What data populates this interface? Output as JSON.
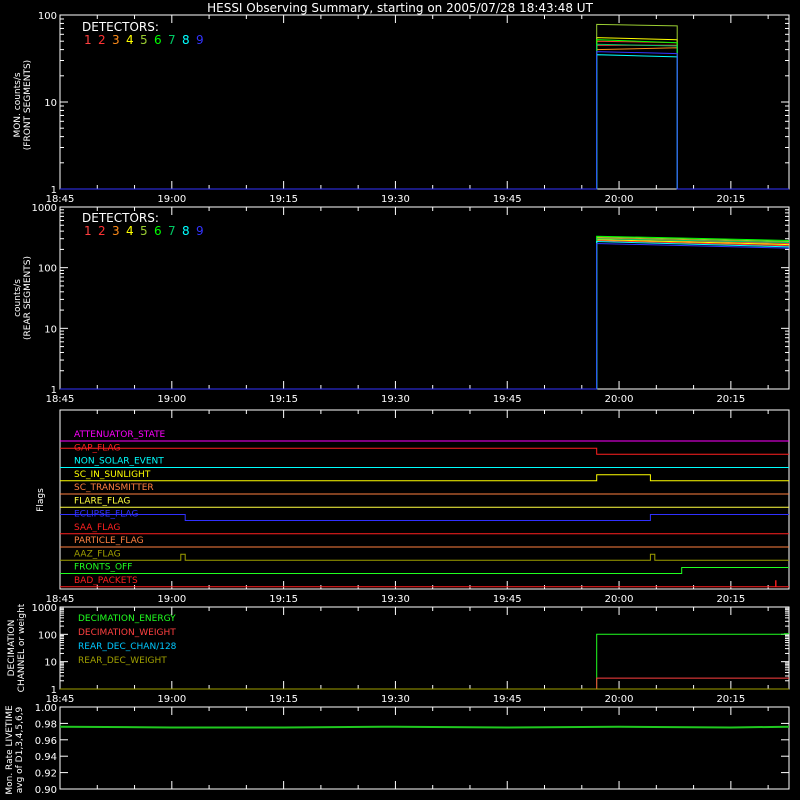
{
  "page": {
    "title": "HESSI Observing Summary, starting on 2005/07/28 18:43:48 UT"
  },
  "time_ticks": [
    "18:45",
    "19:00",
    "19:15",
    "19:30",
    "19:45",
    "20:00",
    "20:15"
  ],
  "chart_data": [
    {
      "type": "line",
      "panel": "front",
      "ylabel_1": "MON. counts/s",
      "ylabel_2": "(FRONT SEGMENTS)",
      "yscale": "log",
      "ylim": [
        1,
        100
      ],
      "yticks": [
        "1",
        "10",
        "100"
      ],
      "legend_title": "DETECTORS:",
      "series": [
        {
          "name": "1",
          "color": "#ff4040",
          "values": [
            [
              18.75,
              1
            ],
            [
              19.95,
              1
            ],
            [
              19.95,
              45
            ],
            [
              20.13,
              45
            ],
            [
              20.13,
              1
            ],
            [
              20.38,
              1
            ]
          ]
        },
        {
          "name": "2",
          "color": "#ff3333",
          "values": [
            [
              18.75,
              1
            ],
            [
              19.95,
              1
            ],
            [
              19.95,
              50
            ],
            [
              20.13,
              48
            ],
            [
              20.13,
              1
            ],
            [
              20.38,
              1
            ]
          ]
        },
        {
          "name": "3",
          "color": "#ff8c1a",
          "values": [
            [
              18.75,
              1
            ],
            [
              19.95,
              1
            ],
            [
              19.95,
              40
            ],
            [
              20.13,
              42
            ],
            [
              20.13,
              1
            ],
            [
              20.38,
              1
            ]
          ]
        },
        {
          "name": "4",
          "color": "#ffff00",
          "values": [
            [
              18.75,
              1
            ],
            [
              19.95,
              1
            ],
            [
              19.95,
              55
            ],
            [
              20.13,
              52
            ],
            [
              20.13,
              1
            ],
            [
              20.38,
              1
            ]
          ]
        },
        {
          "name": "5",
          "color": "#9acd32",
          "values": [
            [
              18.75,
              1
            ],
            [
              19.95,
              1
            ],
            [
              19.95,
              78
            ],
            [
              20.13,
              75
            ],
            [
              20.13,
              1
            ],
            [
              20.38,
              1
            ]
          ]
        },
        {
          "name": "6",
          "color": "#00ff00",
          "values": [
            [
              18.75,
              1
            ],
            [
              19.95,
              1
            ],
            [
              19.95,
              52
            ],
            [
              20.13,
              48
            ],
            [
              20.13,
              1
            ],
            [
              20.38,
              1
            ]
          ]
        },
        {
          "name": "7",
          "color": "#00c864",
          "values": [
            [
              18.75,
              1
            ],
            [
              19.95,
              1
            ],
            [
              19.95,
              46
            ],
            [
              20.13,
              44
            ],
            [
              20.13,
              1
            ],
            [
              20.38,
              1
            ]
          ]
        },
        {
          "name": "8",
          "color": "#00ffff",
          "values": [
            [
              18.75,
              1
            ],
            [
              19.95,
              1
            ],
            [
              19.95,
              35
            ],
            [
              20.13,
              33
            ],
            [
              20.13,
              1
            ],
            [
              20.38,
              1
            ]
          ]
        },
        {
          "name": "9",
          "color": "#3333ff",
          "values": [
            [
              18.75,
              1
            ],
            [
              19.95,
              1
            ],
            [
              19.95,
              38
            ],
            [
              20.13,
              36
            ],
            [
              20.13,
              1
            ],
            [
              20.38,
              1
            ]
          ]
        }
      ]
    },
    {
      "type": "line",
      "panel": "rear",
      "ylabel_1": "counts/s",
      "ylabel_2": "(REAR SEGMENTS)",
      "yscale": "log",
      "ylim": [
        1,
        1000
      ],
      "yticks": [
        "1",
        "10",
        "100",
        "1000"
      ],
      "legend_title": "DETECTORS:",
      "series": [
        {
          "name": "1",
          "color": "#ff4040",
          "values": [
            [
              18.75,
              1
            ],
            [
              19.95,
              1
            ],
            [
              19.95,
              300
            ],
            [
              20.38,
              250
            ]
          ]
        },
        {
          "name": "2",
          "color": "#ff3333",
          "values": [
            [
              18.75,
              1
            ],
            [
              19.95,
              1
            ],
            [
              19.95,
              280
            ],
            [
              20.38,
              230
            ]
          ]
        },
        {
          "name": "3",
          "color": "#ff8c1a",
          "values": [
            [
              18.75,
              1
            ],
            [
              19.95,
              1
            ],
            [
              19.95,
              310
            ],
            [
              20.38,
              260
            ]
          ]
        },
        {
          "name": "4",
          "color": "#ffff00",
          "values": [
            [
              18.75,
              1
            ],
            [
              19.95,
              1
            ],
            [
              19.95,
              290
            ],
            [
              20.38,
              240
            ]
          ]
        },
        {
          "name": "5",
          "color": "#9acd32",
          "values": [
            [
              18.75,
              1
            ],
            [
              19.95,
              1
            ],
            [
              19.95,
              320
            ],
            [
              20.38,
              270
            ]
          ]
        },
        {
          "name": "6",
          "color": "#00ff00",
          "values": [
            [
              18.75,
              1
            ],
            [
              19.95,
              1
            ],
            [
              19.95,
              330
            ],
            [
              20.38,
              280
            ]
          ]
        },
        {
          "name": "7",
          "color": "#00c864",
          "values": [
            [
              18.75,
              1
            ],
            [
              19.95,
              1
            ],
            [
              19.95,
              300
            ],
            [
              20.38,
              260
            ]
          ]
        },
        {
          "name": "8",
          "color": "#00ffff",
          "values": [
            [
              18.75,
              1
            ],
            [
              19.95,
              1
            ],
            [
              19.95,
              270
            ],
            [
              20.38,
              220
            ]
          ]
        },
        {
          "name": "9",
          "color": "#3333ff",
          "values": [
            [
              18.75,
              1
            ],
            [
              19.95,
              1
            ],
            [
              19.95,
              250
            ],
            [
              20.38,
              210
            ]
          ]
        }
      ]
    },
    {
      "type": "line",
      "panel": "flags",
      "ylabel_1": "Flags",
      "flags": [
        {
          "name": "ATTENUATOR_STATE",
          "color": "#ff00ff",
          "values": [
            [
              18.75,
              0
            ],
            [
              20.38,
              0
            ]
          ]
        },
        {
          "name": "GAP_FLAG",
          "color": "#ff2020",
          "values": [
            [
              18.75,
              1
            ],
            [
              19.95,
              1
            ],
            [
              19.95,
              0
            ],
            [
              20.38,
              0
            ]
          ]
        },
        {
          "name": "NON_SOLAR_EVENT",
          "color": "#00ffff",
          "values": [
            [
              18.75,
              0
            ],
            [
              20.38,
              0
            ]
          ]
        },
        {
          "name": "SC_IN_SUNLIGHT",
          "color": "#ffff00",
          "values": [
            [
              18.75,
              0
            ],
            [
              19.95,
              0
            ],
            [
              19.95,
              1
            ],
            [
              20.07,
              1
            ],
            [
              20.07,
              0
            ],
            [
              20.38,
              0
            ]
          ]
        },
        {
          "name": "SC_TRANSMITTER",
          "color": "#ff8040",
          "values": [
            [
              18.75,
              0
            ],
            [
              20.38,
              0
            ]
          ]
        },
        {
          "name": "FLARE_FLAG",
          "color": "#ffff40",
          "values": [
            [
              18.75,
              0
            ],
            [
              20.38,
              0
            ]
          ]
        },
        {
          "name": "ECLIPSE_FLAG",
          "color": "#3030ff",
          "values": [
            [
              18.75,
              1
            ],
            [
              19.03,
              1
            ],
            [
              19.03,
              0
            ],
            [
              20.07,
              0
            ],
            [
              20.07,
              1
            ],
            [
              20.38,
              1
            ]
          ]
        },
        {
          "name": "SAA_FLAG",
          "color": "#ff2020",
          "values": [
            [
              18.75,
              0
            ],
            [
              20.38,
              0
            ]
          ]
        },
        {
          "name": "PARTICLE_FLAG",
          "color": "#ff8040",
          "values": [
            [
              18.75,
              0
            ],
            [
              20.38,
              0
            ]
          ]
        },
        {
          "name": "AAZ_FLAG",
          "color": "#a0a000",
          "values": [
            [
              18.75,
              0
            ],
            [
              19.02,
              0
            ],
            [
              19.02,
              1
            ],
            [
              19.03,
              1
            ],
            [
              19.03,
              0
            ],
            [
              20.07,
              0
            ],
            [
              20.07,
              1
            ],
            [
              20.08,
              1
            ],
            [
              20.08,
              0
            ],
            [
              20.38,
              0
            ]
          ]
        },
        {
          "name": "FRONTS_OFF",
          "color": "#20ff20",
          "values": [
            [
              18.75,
              0
            ],
            [
              20.14,
              0
            ],
            [
              20.14,
              1
            ],
            [
              20.38,
              1
            ]
          ]
        },
        {
          "name": "BAD_PACKETS",
          "color": "#ff2020",
          "values": [
            [
              18.75,
              0
            ],
            [
              20.35,
              0
            ],
            [
              20.35,
              1
            ],
            [
              20.351,
              1
            ],
            [
              20.351,
              0
            ],
            [
              20.38,
              0
            ]
          ]
        }
      ]
    },
    {
      "type": "line",
      "panel": "decimation",
      "ylabel_1": "DECIMATION",
      "ylabel_2": "CHANNEL or weight",
      "yscale": "log",
      "ylim": [
        1,
        1000
      ],
      "yticks": [
        "1",
        "10",
        "100",
        "1000"
      ],
      "series": [
        {
          "name": "DECIMATION_ENERGY",
          "color": "#20ff20",
          "values": [
            [
              18.75,
              1
            ],
            [
              19.95,
              1
            ],
            [
              19.95,
              100
            ],
            [
              20.37,
              100
            ],
            [
              20.37,
              105
            ],
            [
              20.38,
              105
            ]
          ]
        },
        {
          "name": "DECIMATION_WEIGHT",
          "color": "#ff4040",
          "values": [
            [
              18.75,
              1
            ],
            [
              19.95,
              1
            ],
            [
              19.95,
              2.5
            ],
            [
              20.38,
              2.5
            ]
          ]
        },
        {
          "name": "REAR_DEC_CHAN/128",
          "color": "#00c8ff",
          "values": [
            [
              18.75,
              1
            ],
            [
              20.38,
              1
            ]
          ]
        },
        {
          "name": "REAR_DEC_WEIGHT",
          "color": "#a0a000",
          "values": [
            [
              18.75,
              1
            ],
            [
              20.38,
              1
            ]
          ]
        }
      ]
    },
    {
      "type": "line",
      "panel": "livetime",
      "ylabel_1": "Mon. Rate LIVETIME",
      "ylabel_2": "avg of D1,3,4,5,6,9",
      "ylim": [
        0.9,
        1.0
      ],
      "yticks": [
        "0.90",
        "0.92",
        "0.94",
        "0.96",
        "0.98",
        "1.00"
      ],
      "series": [
        {
          "name": "",
          "color": "#20c820",
          "values": [
            [
              18.75,
              0.976
            ],
            [
              19.0,
              0.975
            ],
            [
              19.25,
              0.975
            ],
            [
              19.5,
              0.976
            ],
            [
              19.75,
              0.975
            ],
            [
              20.0,
              0.976
            ],
            [
              20.25,
              0.975
            ],
            [
              20.38,
              0.976
            ]
          ]
        }
      ]
    }
  ]
}
